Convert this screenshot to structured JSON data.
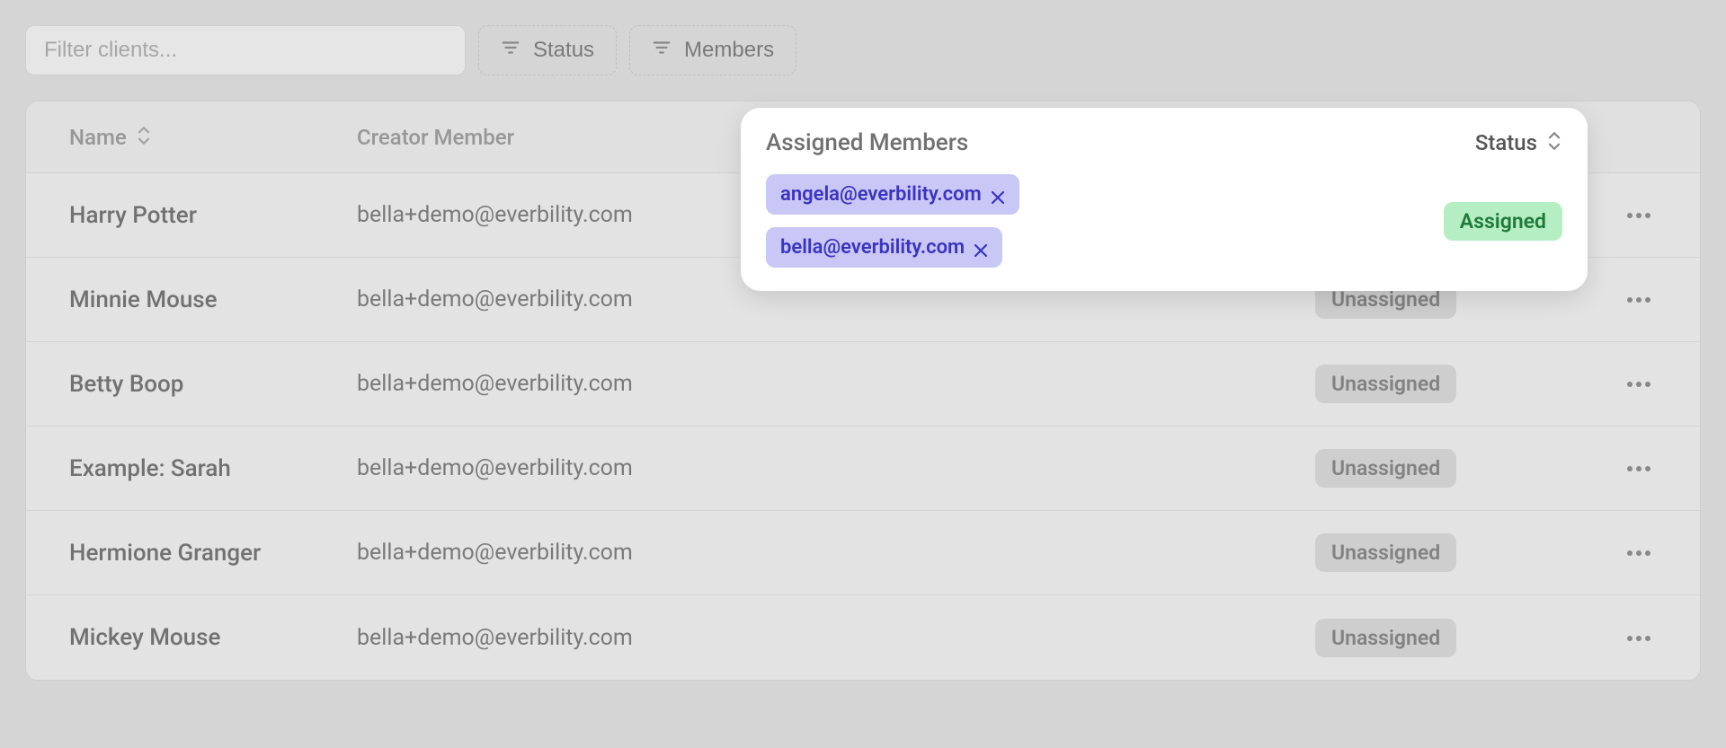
{
  "toolbar": {
    "filter_placeholder": "Filter clients...",
    "status_label": "Status",
    "members_label": "Members"
  },
  "columns": {
    "name": "Name",
    "creator": "Creator Member",
    "assigned": "Assigned Members",
    "status": "Status"
  },
  "status_labels": {
    "assigned": "Assigned",
    "unassigned": "Unassigned"
  },
  "highlight": {
    "title": "Assigned Members",
    "status_label": "Status",
    "status_value": "Assigned",
    "tags": [
      "angela@everbility.com",
      "bella@everbility.com"
    ]
  },
  "rows": [
    {
      "name": "Harry Potter",
      "creator": "bella+demo@everbility.com",
      "assigned": [
        "angela@everbility.com",
        "bella@everbility.com"
      ],
      "status": "assigned"
    },
    {
      "name": "Minnie Mouse",
      "creator": "bella+demo@everbility.com",
      "assigned": [],
      "status": "unassigned"
    },
    {
      "name": "Betty Boop",
      "creator": "bella+demo@everbility.com",
      "assigned": [],
      "status": "unassigned"
    },
    {
      "name": "Example: Sarah",
      "creator": "bella+demo@everbility.com",
      "assigned": [],
      "status": "unassigned"
    },
    {
      "name": "Hermione Granger",
      "creator": "bella+demo@everbility.com",
      "assigned": [],
      "status": "unassigned"
    },
    {
      "name": "Mickey Mouse",
      "creator": "bella+demo@everbility.com",
      "assigned": [],
      "status": "unassigned"
    }
  ]
}
